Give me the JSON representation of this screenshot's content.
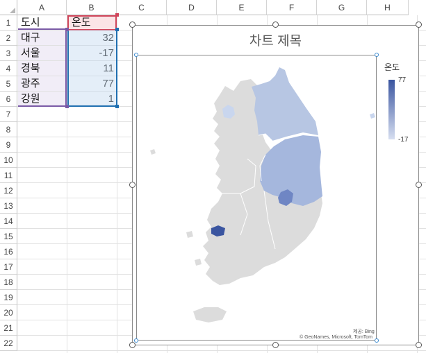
{
  "columns": [
    "A",
    "B",
    "C",
    "D",
    "E",
    "F",
    "G",
    "H"
  ],
  "rows": [
    "1",
    "2",
    "3",
    "4",
    "5",
    "6",
    "7",
    "8",
    "9",
    "10",
    "11",
    "12",
    "13",
    "14",
    "15",
    "16",
    "17",
    "18",
    "19",
    "20",
    "21",
    "22"
  ],
  "table": {
    "headers": [
      "도시",
      "온도"
    ],
    "rows": [
      {
        "city": "대구",
        "temp": "32"
      },
      {
        "city": "서울",
        "temp": "-17"
      },
      {
        "city": "경북",
        "temp": "11"
      },
      {
        "city": "광주",
        "temp": "77"
      },
      {
        "city": "강원",
        "temp": "1"
      }
    ]
  },
  "chart": {
    "title": "차트 제목",
    "legend_title": "온도",
    "legend_max": "77",
    "legend_min": "-17",
    "attribution_line1": "제공: Bing",
    "attribution_line2": "© GeoNames, Microsoft, TomTom",
    "colors": {
      "base_region": "#dcdcdc",
      "low": "#d6def0",
      "high": "#3a55a0",
      "seoul": "#c9d6ee",
      "gangwon": "#b7c6e3",
      "gyeongbuk": "#a5b7dd",
      "daegu": "#6f86c4",
      "gwangju": "#3a55a0"
    }
  }
}
